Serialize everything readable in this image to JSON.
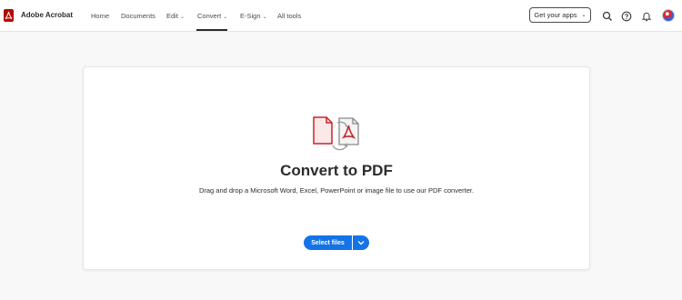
{
  "app": {
    "brand": "Adobe Acrobat",
    "accent_color": "#1473e6",
    "brand_color": "#b30b00"
  },
  "nav": {
    "items": [
      {
        "label": "Home",
        "has_dropdown": false
      },
      {
        "label": "Documents",
        "has_dropdown": false
      },
      {
        "label": "Edit",
        "has_dropdown": true
      },
      {
        "label": "Convert",
        "has_dropdown": true,
        "active": true
      },
      {
        "label": "E-Sign",
        "has_dropdown": true
      },
      {
        "label": "All tools",
        "has_dropdown": false
      }
    ],
    "chevron": "⌄"
  },
  "header_actions": {
    "get_apps_label": "Get your apps",
    "icons": [
      "search-icon",
      "help-icon",
      "bell-icon",
      "apps-grid-icon",
      "avatar"
    ]
  },
  "main": {
    "heading": "Convert to PDF",
    "description": "Drag and drop a Microsoft Word, Excel, PowerPoint or image file to use our PDF converter.",
    "select_files_label": "Select files"
  }
}
